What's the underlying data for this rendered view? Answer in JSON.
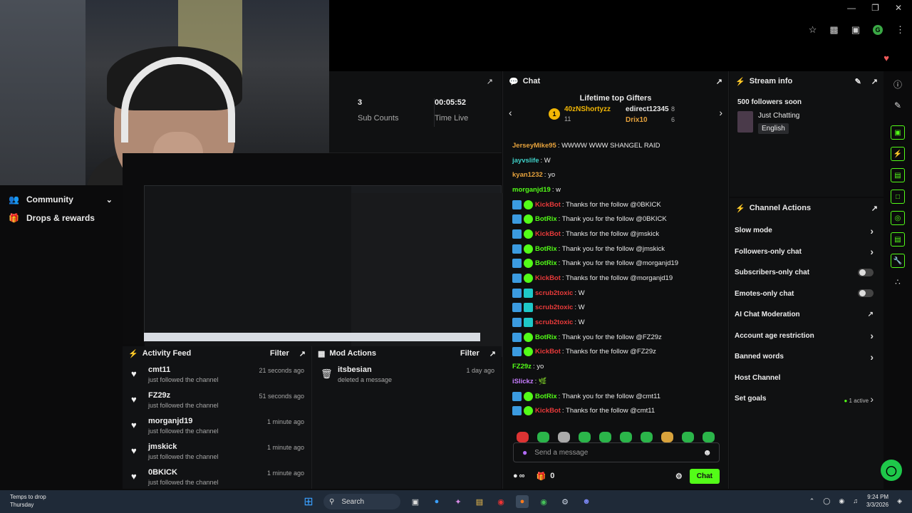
{
  "left_sidebar": {
    "items": [
      {
        "label": "Community",
        "icon": "people-icon"
      },
      {
        "label": "Drops & rewards",
        "icon": "gift-icon"
      }
    ]
  },
  "stats": [
    {
      "value": "3",
      "label": "Sub Counts"
    },
    {
      "value": "00:05:52",
      "label": "Time Live"
    }
  ],
  "activity_feed": {
    "title": "Activity Feed",
    "filter_label": "Filter",
    "items": [
      {
        "name": "cmt11",
        "desc": "just followed the channel",
        "time": "21 seconds ago"
      },
      {
        "name": "FZ29z",
        "desc": "just followed the channel",
        "time": "51 seconds ago"
      },
      {
        "name": "morganjd19",
        "desc": "just followed the channel",
        "time": "1 minute ago"
      },
      {
        "name": "jmskick",
        "desc": "just followed the channel",
        "time": "1 minute ago"
      },
      {
        "name": "0BKICK",
        "desc": "just followed the channel",
        "time": "1 minute ago"
      }
    ]
  },
  "mod_actions": {
    "title": "Mod Actions",
    "filter_label": "Filter",
    "items": [
      {
        "name": "itsbesian",
        "desc": "deleted a message",
        "time": "1 day ago"
      }
    ]
  },
  "chat": {
    "title": "Chat",
    "gifters_title": "Lifetime top Gifters",
    "gifters": [
      {
        "rank": "1",
        "name": "40zNShortyzz",
        "count": "11"
      },
      {
        "name": "edirect12345",
        "count": "8"
      },
      {
        "name": "Drix10",
        "count": "6"
      }
    ],
    "messages": [
      {
        "user": "JerseyMike95",
        "color": "#e6a23c",
        "badges": [],
        "text": ": WWWW WWW SHANGEL RAID"
      },
      {
        "user": "jayvslife",
        "color": "#3fd1c8",
        "badges": [],
        "text": ": W"
      },
      {
        "user": "kyan1232",
        "color": "#e6a23c",
        "badges": [],
        "text": ": yo"
      },
      {
        "user": "morganjd19",
        "color": "#53fc18",
        "badges": [],
        "text": ": w"
      },
      {
        "user": "KickBot",
        "color": "#e83a3a",
        "badges": [
          "mod",
          "ver"
        ],
        "text": ": Thanks for the follow @0BKICK"
      },
      {
        "user": "BotRix",
        "color": "#53fc18",
        "badges": [
          "mod",
          "ver"
        ],
        "text": ": Thank you for the follow @0BKICK"
      },
      {
        "user": "KickBot",
        "color": "#e83a3a",
        "badges": [
          "mod",
          "ver"
        ],
        "text": ": Thanks for the follow @jmskick"
      },
      {
        "user": "BotRix",
        "color": "#53fc18",
        "badges": [
          "mod",
          "ver"
        ],
        "text": ": Thank you for the follow @jmskick"
      },
      {
        "user": "BotRix",
        "color": "#53fc18",
        "badges": [
          "mod",
          "ver"
        ],
        "text": ": Thank you for the follow @morganjd19"
      },
      {
        "user": "KickBot",
        "color": "#e83a3a",
        "badges": [
          "mod",
          "ver"
        ],
        "text": ": Thanks for the follow @morganjd19"
      },
      {
        "user": "scrub2toxic",
        "color": "#e83a3a",
        "badges": [
          "mod",
          "sub"
        ],
        "text": ": W"
      },
      {
        "user": "scrub2toxic",
        "color": "#e83a3a",
        "badges": [
          "mod",
          "sub"
        ],
        "text": ": W"
      },
      {
        "user": "scrub2toxic",
        "color": "#e83a3a",
        "badges": [
          "mod",
          "sub"
        ],
        "text": ": W"
      },
      {
        "user": "BotRix",
        "color": "#53fc18",
        "badges": [
          "mod",
          "ver"
        ],
        "text": ": Thank you for the follow @FZ29z"
      },
      {
        "user": "KickBot",
        "color": "#e83a3a",
        "badges": [
          "mod",
          "ver"
        ],
        "text": ": Thanks for the follow @FZ29z"
      },
      {
        "user": "FZ29z",
        "color": "#53fc18",
        "badges": [],
        "text": ": yo"
      },
      {
        "user": "iSlickz",
        "color": "#c77dff",
        "badges": [],
        "text": ": 🌿"
      },
      {
        "user": "BotRix",
        "color": "#53fc18",
        "badges": [
          "mod",
          "ver"
        ],
        "text": ": Thank you for the follow @cmt11"
      },
      {
        "user": "KickBot",
        "color": "#e83a3a",
        "badges": [
          "mod",
          "ver"
        ],
        "text": ": Thanks for the follow @cmt11"
      }
    ],
    "input_placeholder": "Send a message",
    "infinity_label": "∞",
    "gift_count": "0",
    "send_label": "Chat"
  },
  "stream_info": {
    "title": "Stream info",
    "followers_text": "500 followers soon",
    "category": "Just Chatting",
    "language": "English"
  },
  "channel_actions": {
    "title": "Channel Actions",
    "items": [
      {
        "label": "Slow mode",
        "control": "chevron"
      },
      {
        "label": "Followers-only chat",
        "control": "chevron"
      },
      {
        "label": "Subscribers-only chat",
        "control": "toggle"
      },
      {
        "label": "Emotes-only chat",
        "control": "toggle"
      },
      {
        "label": "AI Chat Moderation",
        "control": "external"
      },
      {
        "label": "Account age restriction",
        "control": "chevron"
      },
      {
        "label": "Banned words",
        "control": "chevron"
      },
      {
        "label": "Host Channel",
        "control": "none"
      },
      {
        "label": "Set goals",
        "control": "active",
        "extra": "1 active"
      }
    ]
  },
  "taskbar": {
    "weather_line1": "Temps to drop",
    "weather_line2": "Thursday",
    "search_label": "Search",
    "time": "9:24 PM",
    "date": "3/3/2026"
  },
  "colors": {
    "accent": "#53fc18",
    "bg": "#0b0b0c",
    "panel": "#111214"
  }
}
